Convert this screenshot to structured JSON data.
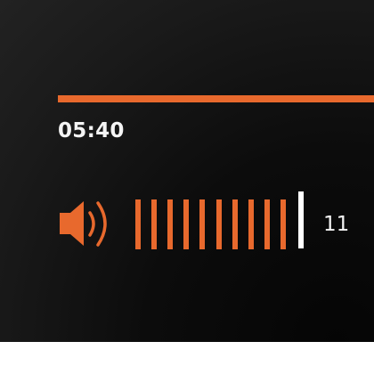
{
  "player": {
    "accent_color": "#e8692d",
    "progress_fraction": 1.0,
    "elapsed_time": "05:40"
  },
  "volume": {
    "icon": "speaker-volume-icon",
    "level": 11,
    "level_label": "11",
    "segments_filled": 10,
    "segments_total": 10
  }
}
